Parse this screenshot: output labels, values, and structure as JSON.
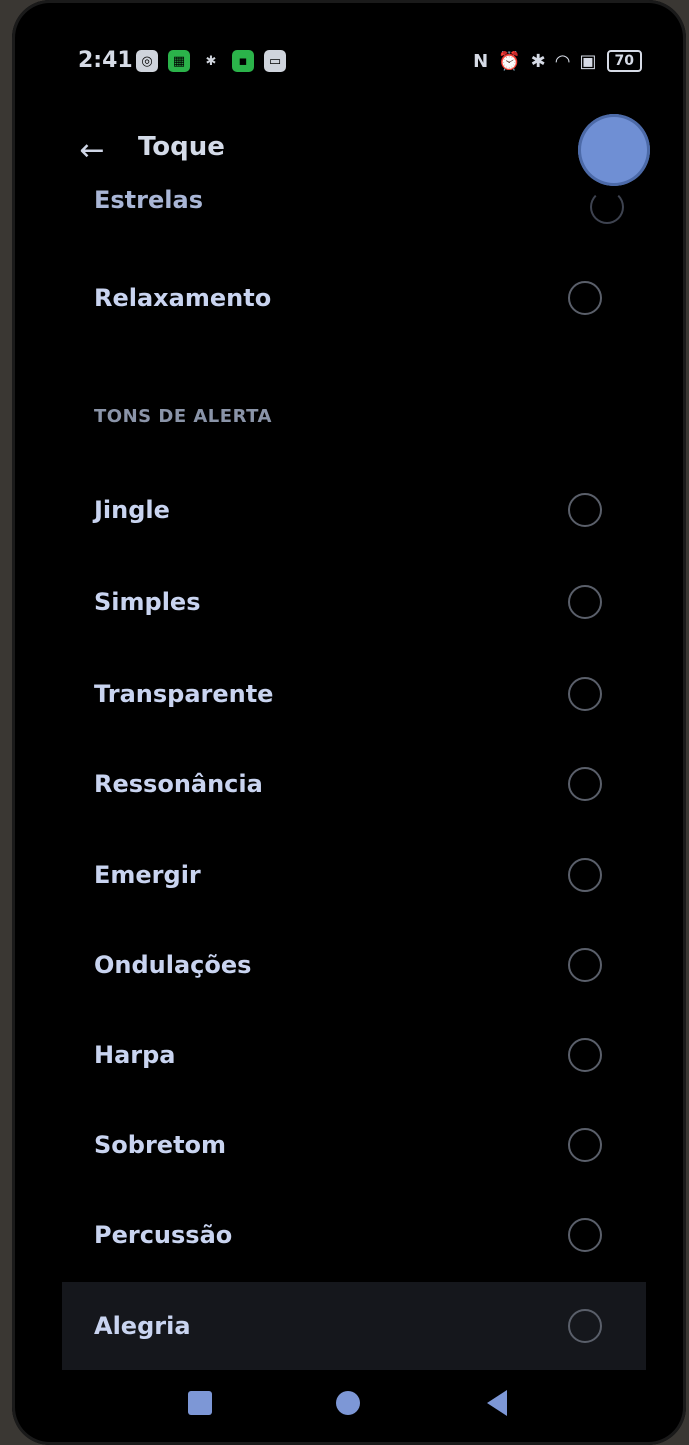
{
  "status_bar": {
    "time": "2:41",
    "battery": "70"
  },
  "app_bar": {
    "title": "Toque"
  },
  "partial_item": "Estrelas",
  "top_item": "Relaxamento",
  "section_header": "TONS DE ALERTA",
  "alert_tones": [
    "Jingle",
    "Simples",
    "Transparente",
    "Ressonância",
    "Emergir",
    "Ondulações",
    "Harpa",
    "Sobretom",
    "Percussão",
    "Alegria"
  ],
  "icons": {
    "back": "arrow-left-icon",
    "radio": "radio-unselected-icon",
    "nav_recent": "square-icon",
    "nav_home": "circle-icon",
    "nav_back": "triangle-left-icon"
  },
  "colors": {
    "background": "#000000",
    "text": "#c9d4f0",
    "accent": "#7d97d6"
  }
}
